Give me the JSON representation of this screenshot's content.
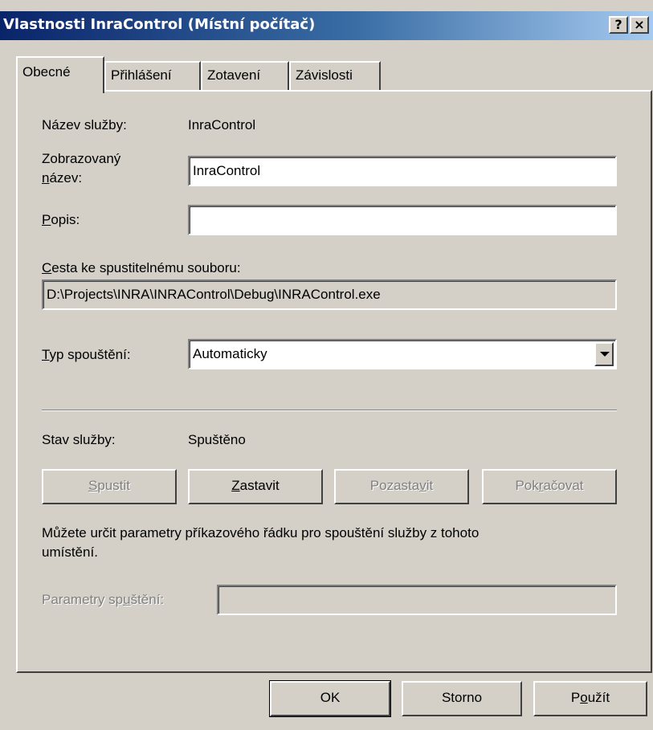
{
  "window": {
    "title": "Vlastnosti InraControl (Místní počítač)",
    "help_glyph": "?",
    "close_glyph": "×"
  },
  "tabs": [
    {
      "label": "Obecné",
      "active": true
    },
    {
      "label": "Přihlášení",
      "active": false
    },
    {
      "label": "Zotavení",
      "active": false
    },
    {
      "label": "Závislosti",
      "active": false
    }
  ],
  "general": {
    "service_name_label": "Název služby:",
    "service_name_value": "InraControl",
    "display_name_label_1": "Zobrazovaný",
    "display_name_label_2_mnemonic": "n",
    "display_name_label_2_rest": "ázev:",
    "display_name_value": "InraControl",
    "description_label_mnemonic": "P",
    "description_label_rest": "opis:",
    "description_value": "",
    "path_label_mnemonic": "C",
    "path_label_rest": "esta ke spustitelnému souboru:",
    "path_value": "D:\\Projects\\INRA\\INRAControl\\Debug\\INRAControl.exe",
    "startup_label_mnemonic": "T",
    "startup_label_rest": "yp spouštění:",
    "startup_value": "Automaticky",
    "status_label": "Stav služby:",
    "status_value": "Spuštěno"
  },
  "service_buttons": {
    "start_mnemonic": "S",
    "start_rest": "pustit",
    "stop_mnemonic": "Z",
    "stop_rest": "astavit",
    "pause_pre": "Pozasta",
    "pause_mnemonic": "v",
    "pause_rest": "it",
    "resume_pre": "Pok",
    "resume_mnemonic": "r",
    "resume_rest": "ačovat"
  },
  "params": {
    "hint_line1": "Můžete určit parametry příkazového řádku pro spouštění služby z tohoto",
    "hint_line2": "umístění.",
    "label_pre": "Parametry sp",
    "label_mnemonic": "u",
    "label_rest": "štění:",
    "value": ""
  },
  "footer": {
    "ok_label": "OK",
    "cancel_label": "Storno",
    "apply_pre": "P",
    "apply_mnemonic": "o",
    "apply_rest": "užít"
  }
}
